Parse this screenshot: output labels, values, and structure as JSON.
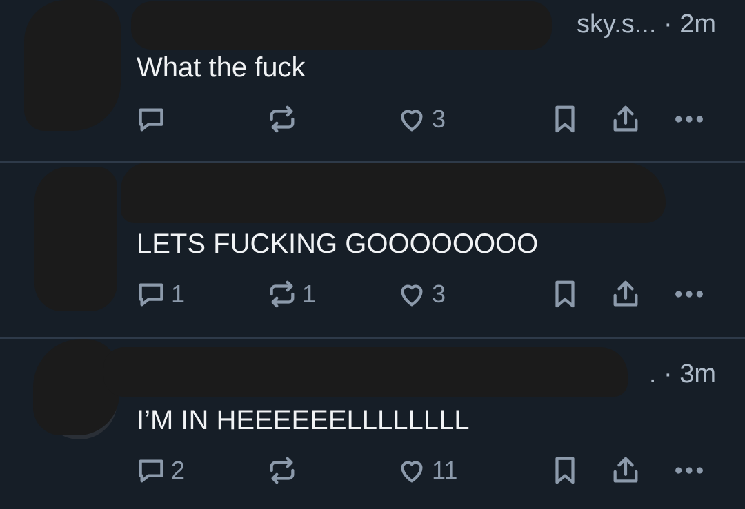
{
  "posts": [
    {
      "handle_suffix": "sky.s...",
      "time": "2m",
      "text": "What the fuck",
      "replies": "",
      "reposts": "",
      "likes": "3"
    },
    {
      "handle_suffix": "",
      "time": "",
      "text": "LETS FUCKING GOOOOOOOO",
      "replies": "1",
      "reposts": "1",
      "likes": "3"
    },
    {
      "handle_suffix": ".",
      "time": "3m",
      "text": "I’M IN HEEEEEELLLLLLLL",
      "replies": "2",
      "reposts": "",
      "likes": "11"
    }
  ],
  "icons": {
    "reply": "reply-icon",
    "repost": "repost-icon",
    "like": "heart-icon",
    "bookmark": "bookmark-icon",
    "share": "share-icon",
    "more": "more-dots-icon"
  },
  "colors": {
    "background": "#161e27",
    "text": "#f1f3f5",
    "muted": "#8c9aab",
    "divider": "#2e3a49"
  }
}
